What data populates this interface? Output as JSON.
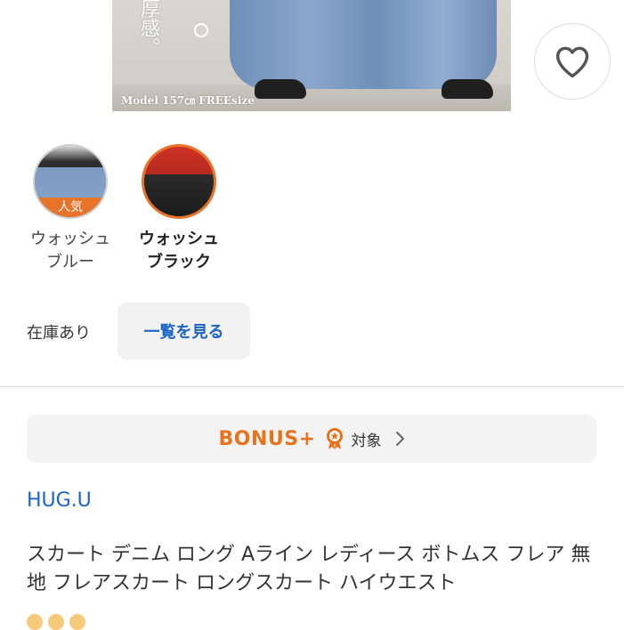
{
  "hero": {
    "vertical_text": "厚感。",
    "caption": "Model 157㎝ FREEsize"
  },
  "favorite": {
    "icon": "heart-icon"
  },
  "variants": [
    {
      "name_line1": "ウォッシュ",
      "name_line2": "ブルー",
      "badge": "人気",
      "selected": false
    },
    {
      "name_line1": "ウォッシュ",
      "name_line2": "ブラック",
      "selected": true
    }
  ],
  "stock": {
    "status": "在庫あり",
    "list_button": "一覧を見る"
  },
  "bonus": {
    "logo": "BONUS+",
    "label": "対象",
    "accent": "#e8731e"
  },
  "product": {
    "brand": "HUG.U",
    "title": "スカート デニム ロング Aライン レディース ボトムス フレア 無地 フレアスカート ロングスカート ハイウエスト"
  },
  "colors": {
    "accent_orange": "#e8732a",
    "link_blue": "#1a64c8"
  }
}
